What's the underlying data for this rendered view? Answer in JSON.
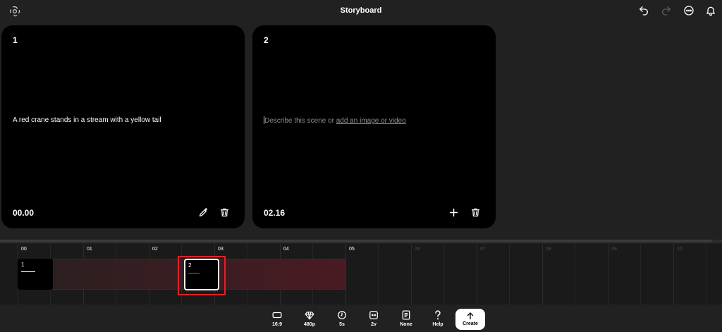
{
  "header": {
    "title": "Storyboard",
    "icons": [
      "openai-logo-icon",
      "undo-icon",
      "redo-icon",
      "more-options-icon",
      "notifications-icon"
    ]
  },
  "scenes": [
    {
      "number": "1",
      "description": "A red crane stands in a stream with a yellow tail",
      "time": "00.00"
    },
    {
      "number": "2",
      "placeholder_text": "Describe this scene or ",
      "placeholder_link": "add an image or video",
      "time": "02.16"
    }
  ],
  "timeline": {
    "ruler": [
      "00",
      "01",
      "02",
      "03",
      "04",
      "05",
      "06",
      "07",
      "08",
      "09",
      "10"
    ],
    "clips": [
      {
        "label": "1"
      },
      {
        "label": "2"
      }
    ]
  },
  "toolbar": {
    "aspect_label": "16:9",
    "resolution_label": "480p",
    "duration_label": "5s",
    "variations_label": "2v",
    "preset_label": "None",
    "help_label": "Help",
    "create_label": "Create"
  },
  "colors": {
    "background": "#212121",
    "card": "#000000",
    "highlight": "#e0202a",
    "track": "#4a1a22"
  }
}
